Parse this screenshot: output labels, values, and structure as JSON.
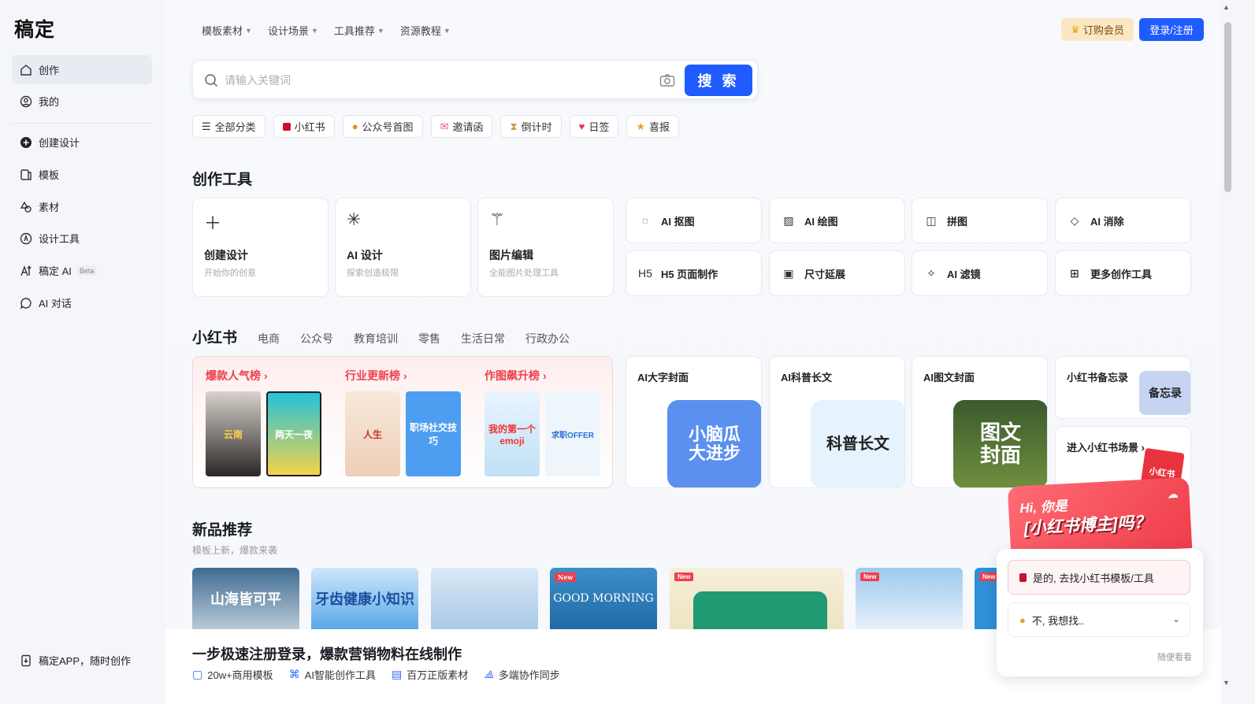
{
  "app": {
    "logo": "稿定"
  },
  "sidebar": {
    "items": [
      {
        "label": "创作",
        "icon": "home-icon"
      },
      {
        "label": "我的",
        "icon": "user-icon"
      },
      {
        "label": "创建设计",
        "icon": "plus-circle-icon"
      },
      {
        "label": "模板",
        "icon": "template-icon"
      },
      {
        "label": "素材",
        "icon": "shapes-icon"
      },
      {
        "label": "设计工具",
        "icon": "tool-icon"
      },
      {
        "label": "稿定 AI",
        "badge": "Beta",
        "icon": "ai-icon"
      },
      {
        "label": "AI 对话",
        "icon": "chat-icon"
      }
    ],
    "footer": "稿定APP，随时创作"
  },
  "topnav": {
    "items": [
      "模板素材",
      "设计场景",
      "工具推荐",
      "资源教程"
    ],
    "vip": "订购会员",
    "login": "登录/注册"
  },
  "search": {
    "placeholder": "请输入关键词",
    "button": "搜 索"
  },
  "chips": [
    {
      "label": "全部分类",
      "color": "#555555"
    },
    {
      "label": "小红书",
      "color": "#c8102e"
    },
    {
      "label": "公众号首图",
      "color": "#f08a1c"
    },
    {
      "label": "邀请函",
      "color": "#e85a87"
    },
    {
      "label": "倒计时",
      "color": "#d6a84a"
    },
    {
      "label": "日签",
      "color": "#e8334a"
    },
    {
      "label": "喜报",
      "color": "#e6a21a"
    }
  ],
  "tools": {
    "title": "创作工具",
    "big": [
      {
        "title": "创建设计",
        "sub": "开始你的创意",
        "icon": "plus-icon"
      },
      {
        "title": "AI 设计",
        "sub": "探索创造极限",
        "icon": "sparkle-icon"
      },
      {
        "title": "图片编辑",
        "sub": "全能图片处理工具",
        "icon": "magic-wand-icon"
      }
    ],
    "small": [
      {
        "label": "AI 抠图",
        "icon": "cutout-icon"
      },
      {
        "label": "AI 绘图",
        "icon": "image-plus-icon"
      },
      {
        "label": "拼图",
        "icon": "grid-icon"
      },
      {
        "label": "AI 消除",
        "icon": "eraser-icon"
      },
      {
        "label": "H5 页面制作",
        "icon": "h5-icon"
      },
      {
        "label": "尺寸延展",
        "icon": "resize-icon"
      },
      {
        "label": "AI 滤镜",
        "icon": "filter-icon"
      },
      {
        "label": "更多创作工具",
        "icon": "apps-icon"
      }
    ]
  },
  "scene_tabs": [
    "小红书",
    "电商",
    "公众号",
    "教育培训",
    "零售",
    "生活日常",
    "行政办公"
  ],
  "rank": {
    "cols": [
      {
        "title": "爆款人气榜",
        "thumbs": [
          "云南",
          "两天一夜"
        ]
      },
      {
        "title": "行业更新榜",
        "thumbs": [
          "人生",
          "职场社交技巧"
        ]
      },
      {
        "title": "作图飙升榜",
        "thumbs": [
          "我的第一个emoji",
          "求职OFFER"
        ]
      }
    ]
  },
  "xhs_cards": [
    {
      "title": "AI大字封面",
      "img": "小脑瓜\n大进步"
    },
    {
      "title": "AI科普长文",
      "img": "科普长文"
    },
    {
      "title": "AI图文封面",
      "img": "图文\n封面"
    }
  ],
  "memo_card": {
    "title": "小红书备忘录",
    "img": "备忘录"
  },
  "enter_card": {
    "title": "进入小红书场景",
    "img": "小红书"
  },
  "new": {
    "title": "新品推荐",
    "sub": "模板上新，爆款来袭",
    "templates": [
      {
        "text": "山海皆可平",
        "new": false
      },
      {
        "text": "牙齿健康小知识",
        "new": false
      },
      {
        "text": "",
        "new": false
      },
      {
        "text": "GOOD MORNING",
        "new": true
      },
      {
        "text": "",
        "new": true
      },
      {
        "text": "",
        "new": true
      },
      {
        "text": "",
        "new": true
      }
    ],
    "badge": "New"
  },
  "bottom": {
    "title": "一步极速注册登录，爆款营销物料在线制作",
    "features": [
      "20w+商用模板",
      "AI智能创作工具",
      "百万正版素材",
      "多端协作同步"
    ]
  },
  "popup": {
    "line1": "Hi, 你是",
    "line2": "[小红书博主]吗？",
    "opt1": "是的, 去找小红书模板/工具",
    "opt2": "不, 我想找..",
    "later": "随便看看"
  }
}
